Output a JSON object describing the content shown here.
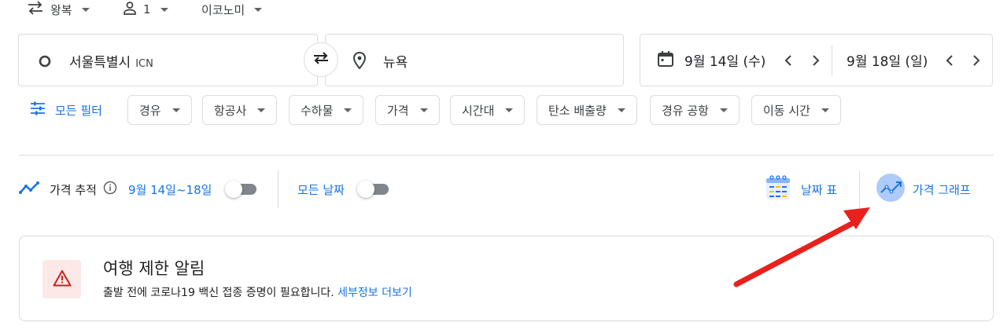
{
  "trip_options": {
    "trip_type": "왕복",
    "passengers": "1",
    "cabin_class": "이코노미"
  },
  "search": {
    "origin": "서울특별시",
    "origin_code": "ICN",
    "destination": "뉴욕",
    "depart_date": "9월 14일 (수)",
    "return_date": "9월 18일 (일)"
  },
  "filters": {
    "all_filters_label": "모든 필터",
    "chips": [
      "경유",
      "항공사",
      "수하물",
      "가격",
      "시간대",
      "탄소 배출량",
      "경유 공항",
      "이동 시간"
    ]
  },
  "tracking": {
    "label": "가격 추적",
    "date_range": "9월 14일~18일",
    "any_dates_label": "모든 날짜",
    "date_grid_label": "날짜 표",
    "price_graph_label": "가격 그래프"
  },
  "advisory": {
    "title": "여행 제한 알림",
    "body": "출발 전에 코로나19 백신 접종 증명이 필요합니다.",
    "link": "세부정보 더보기"
  },
  "colors": {
    "accent": "#1a73e8",
    "annotation_arrow": "#e8211d",
    "warning": "#c5221f"
  },
  "icons": [
    "swap-icon",
    "person-icon",
    "origin-circle-icon",
    "swap-arrows-icon",
    "location-pin-icon",
    "calendar-icon",
    "chevron-left-icon",
    "chevron-right-icon",
    "tune-icon",
    "trending-icon",
    "info-icon",
    "date-grid-icon",
    "price-graph-icon",
    "warning-icon"
  ]
}
